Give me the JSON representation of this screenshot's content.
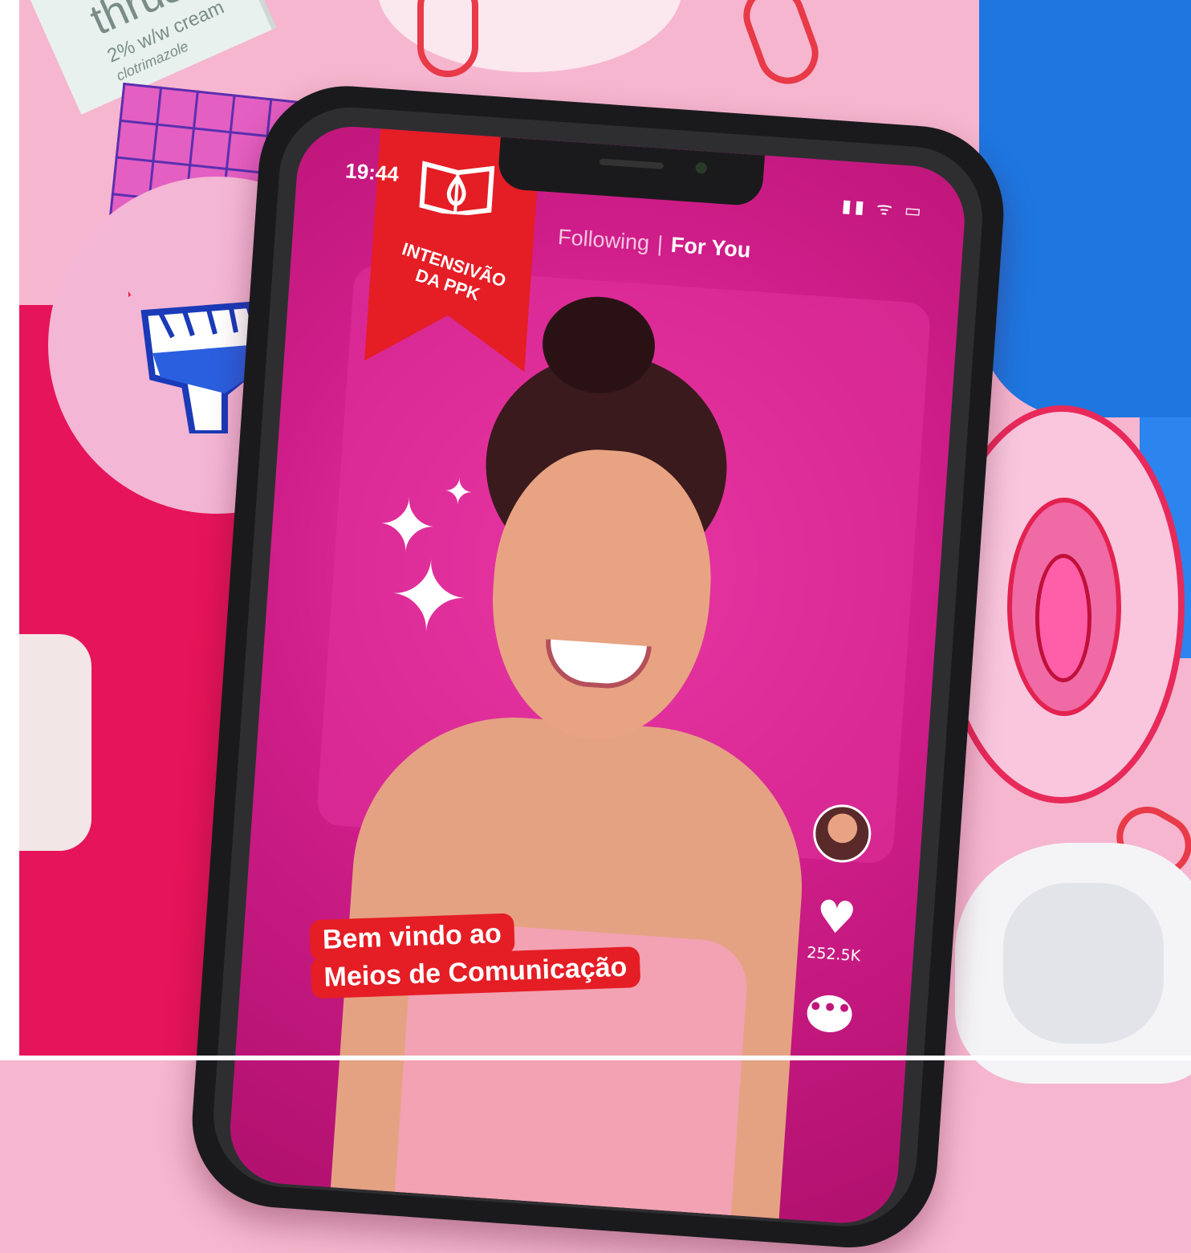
{
  "background_product": {
    "line1": "thrush",
    "line2": "2% w/w cream",
    "line3": "clotrimazole"
  },
  "phone": {
    "status_bar": {
      "time": "19:44",
      "icons": "▮▮ ᯤ ▭"
    },
    "feed_tabs": {
      "following": "Following",
      "separator": "|",
      "for_you": "For You"
    },
    "ribbon_badge": {
      "title_line1": "INTENSIVÃO",
      "title_line2": "DA PPK"
    },
    "caption": {
      "line1": "Bem vindo ao",
      "line2": "Meios de Comunicação"
    },
    "actions": {
      "like_count": "252.5K",
      "like_icon": "heart-icon",
      "comment_icon": "comment-icon",
      "comment_glyph": "•••"
    }
  },
  "colors": {
    "accent_red": "#e51d25",
    "screen_pink": "#d01e8a",
    "background_pink": "#f6b6cf",
    "cloth_blue": "#1e76e0"
  }
}
